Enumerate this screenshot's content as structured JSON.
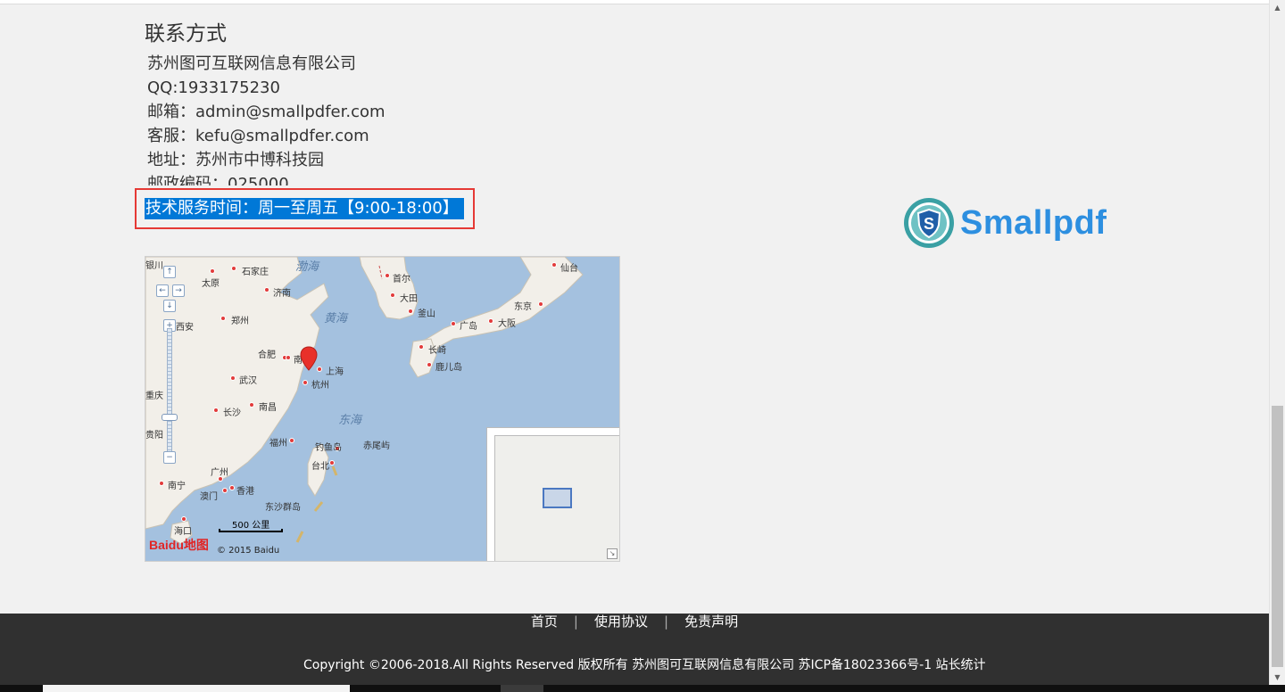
{
  "contact": {
    "heading": "联系方式",
    "company": "苏州图可互联网信息有限公司",
    "qq": "QQ:1933175230",
    "email": "邮箱：admin@smallpdfer.com",
    "service": "客服：kefu@smallpdfer.com",
    "address": "地址：苏州市中博科技园",
    "postcode": "邮政编码：025000",
    "hours": "技术服务时间：周一至周五【9:00-18:00】"
  },
  "logo": {
    "text": "Smallpdf",
    "icon": "shield-s-icon",
    "color": "#2d8fe0"
  },
  "map": {
    "seas": [
      "渤海",
      "黄海",
      "东海"
    ],
    "cities": [
      "银川",
      "太原",
      "石家庄",
      "济南",
      "首尔",
      "大田",
      "釜山",
      "仙台",
      "东京",
      "大阪",
      "广岛",
      "长崎",
      "鹿儿岛",
      "西安",
      "郑州",
      "合肥",
      "南京",
      "上海",
      "杭州",
      "武汉",
      "重庆",
      "长沙",
      "南昌",
      "贵阳",
      "福州",
      "钓鱼岛",
      "赤尾屿",
      "台北",
      "广州",
      "南宁",
      "澳门",
      "香港",
      "东沙群岛",
      "海口"
    ],
    "scale": "500 公里",
    "brand": "Baidu地图",
    "copyright": "© 2015 Baidu",
    "marker": "location-marker-icon"
  },
  "footer": {
    "links": [
      "首页",
      "使用协议",
      "免责声明"
    ],
    "copyright": "Copyright ©2006-2018.All Rights Reserved 版权所有 苏州图可互联网信息有限公司 苏ICP备18023366号-1 站长统计"
  },
  "colors": {
    "highlight_border": "#e53935",
    "selection": "#0078d7",
    "footer_bg": "#303030"
  }
}
